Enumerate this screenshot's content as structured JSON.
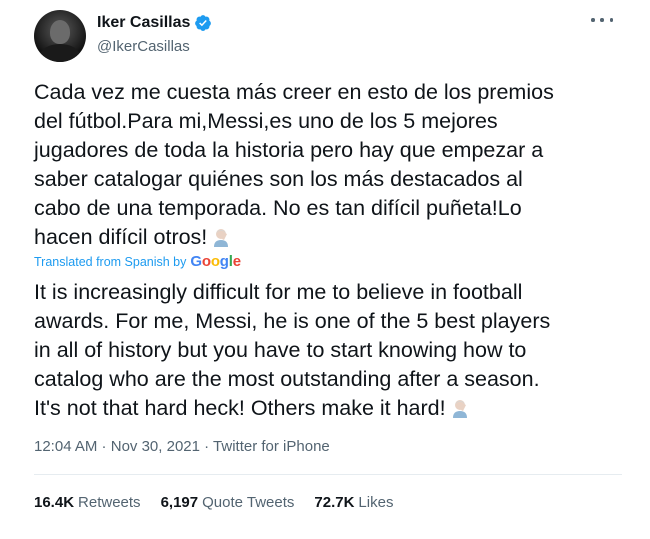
{
  "author": {
    "display_name": "Iker Casillas",
    "handle": "@IkerCasillas",
    "verified": true
  },
  "tweet": {
    "original_lines": [
      "Cada vez me cuesta más creer en esto de los premios",
      "del fútbol.Para mi,Messi,es uno de los 5 mejores",
      "jugadores de toda la historia pero hay que empezar a",
      "saber catalogar quiénes son los más destacados al",
      "cabo de una temporada. No es tan difícil puñeta!Lo",
      "hacen difícil otros!"
    ],
    "translated_by_label": "Translated from Spanish by",
    "translator_letters": [
      "G",
      "o",
      "o",
      "g",
      "l",
      "e"
    ],
    "translated_lines": [
      "It is increasingly difficult for me to believe in football",
      "awards. For me, Messi, he is one of the 5 best players",
      "in all of history but you have to start knowing how to",
      "catalog who are the most outstanding after a season.",
      "It's not that hard heck! Others make it hard!"
    ],
    "emoji": "man-facepalming-icon"
  },
  "meta": {
    "time": "12:04 AM",
    "separator": " · ",
    "date": "Nov 30, 2021",
    "source": "Twitter for iPhone"
  },
  "stats": {
    "retweets_count": "16.4K",
    "retweets_label": "Retweets",
    "quotes_count": "6,197",
    "quotes_label": "Quote Tweets",
    "likes_count": "72.7K",
    "likes_label": "Likes"
  },
  "colors": {
    "verified_blue": "#1d9bf0",
    "secondary_text": "#536471",
    "primary_text": "#0f1419"
  }
}
